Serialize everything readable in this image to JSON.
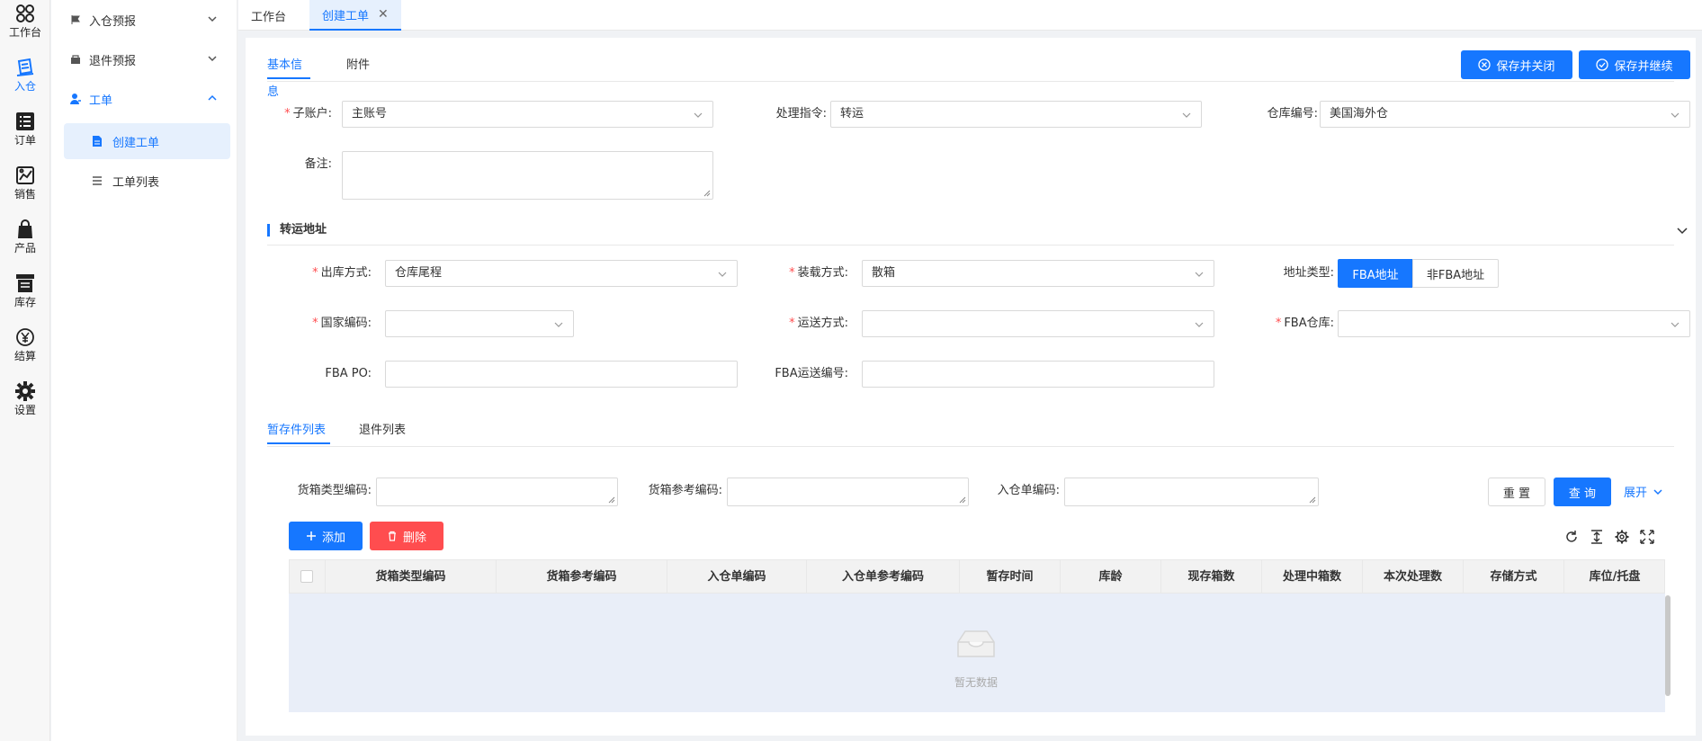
{
  "rail": [
    {
      "id": "workbench",
      "label": "工作台",
      "icon": "clover-icon"
    },
    {
      "id": "inbound",
      "label": "入仓",
      "icon": "inbound-icon"
    },
    {
      "id": "order",
      "label": "订单",
      "icon": "list-icon"
    },
    {
      "id": "sales",
      "label": "销售",
      "icon": "sales-icon"
    },
    {
      "id": "product",
      "label": "产品",
      "icon": "bag-icon"
    },
    {
      "id": "inventory",
      "label": "库存",
      "icon": "inventory-icon"
    },
    {
      "id": "settlement",
      "label": "结算",
      "icon": "yen-icon"
    },
    {
      "id": "settings",
      "label": "设置",
      "icon": "gear-icon"
    }
  ],
  "menu": {
    "items": [
      {
        "label": "入仓预报"
      },
      {
        "label": "退件预报"
      },
      {
        "label": "工单"
      }
    ],
    "sub_items": [
      {
        "label": "创建工单"
      },
      {
        "label": "工单列表"
      }
    ]
  },
  "tabbar": {
    "tabs": [
      {
        "label": "工作台"
      },
      {
        "label": "创建工单"
      }
    ]
  },
  "content_tabs": [
    {
      "label": "基本信息"
    },
    {
      "label": "附件"
    }
  ],
  "actions": {
    "save_close": "保存并关闭",
    "save_continue": "保存并继续"
  },
  "form": {
    "sub_account": {
      "label": "子账户:",
      "value": "主账号"
    },
    "instruction": {
      "label": "处理指令:",
      "value": "转运"
    },
    "warehouse": {
      "label": "仓库编号:",
      "value": "美国海外仓"
    },
    "remark": {
      "label": "备注:"
    }
  },
  "transfer": {
    "title": "转运地址",
    "outbound_method": {
      "label": "出库方式:",
      "value": "仓库尾程"
    },
    "loading_method": {
      "label": "装载方式:",
      "value": "散箱"
    },
    "address_type": {
      "label": "地址类型:",
      "options": [
        "FBA地址",
        "非FBA地址"
      ]
    },
    "country_code": {
      "label": "国家编码:"
    },
    "shipping_method": {
      "label": "运送方式:"
    },
    "fba_warehouse": {
      "label": "FBA仓库:"
    },
    "fba_po": {
      "label": "FBA PO:"
    },
    "fba_shipment_no": {
      "label": "FBA运送编号:"
    }
  },
  "list_tabs": [
    {
      "label": "暂存件列表"
    },
    {
      "label": "退件列表"
    }
  ],
  "filters": {
    "box_type_code": "货箱类型编码:",
    "box_ref_code": "货箱参考编码:",
    "inbound_no": "入仓单编码:",
    "reset": "重 置",
    "query": "查 询",
    "expand": "展开"
  },
  "table_actions": {
    "add": "添加",
    "delete": "删除"
  },
  "table": {
    "columns": [
      "货箱类型编码",
      "货箱参考编码",
      "入仓单编码",
      "入仓单参考编码",
      "暂存时间",
      "库龄",
      "现存箱数",
      "处理中箱数",
      "本次处理数",
      "存储方式",
      "库位/托盘"
    ],
    "empty_text": "暂无数据"
  },
  "colors": {
    "primary": "#1677ff",
    "danger": "#ff4d4f",
    "active_bg": "#e6f0fd"
  }
}
